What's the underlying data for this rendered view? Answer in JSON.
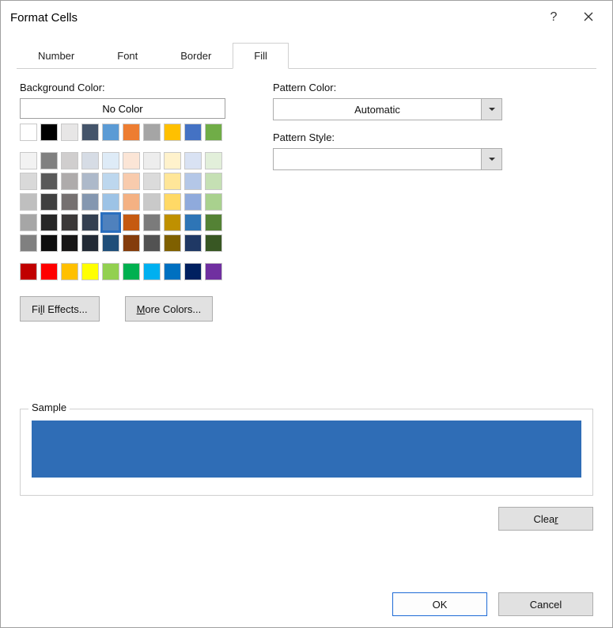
{
  "title": "Format Cells",
  "tabs": [
    "Number",
    "Font",
    "Border",
    "Fill"
  ],
  "active_tab": "Fill",
  "labels": {
    "background_color": "Background Color:",
    "pattern_color": "Pattern Color:",
    "pattern_style": "Pattern Style:",
    "no_color": "No Color",
    "sample": "Sample"
  },
  "buttons": {
    "fill_effects": "Fill Effects...",
    "more_colors": "More Colors...",
    "ok": "OK",
    "cancel": "Cancel",
    "clear": "Clear"
  },
  "dropdowns": {
    "pattern_color_value": "Automatic",
    "pattern_style_value": ""
  },
  "selected_color": "#4f81bd",
  "sample_color": "#2f6db6",
  "palette": {
    "theme_row": [
      "#ffffff",
      "#000000",
      "#e7e6e6",
      "#44546a",
      "#5b9bd5",
      "#ed7d31",
      "#a5a5a5",
      "#ffc000",
      "#4472c4",
      "#70ad47"
    ],
    "tints": [
      [
        "#f2f2f2",
        "#808080",
        "#d0cece",
        "#d6dce5",
        "#deebf7",
        "#fbe5d6",
        "#ededed",
        "#fff2cc",
        "#d9e2f3",
        "#e2efda"
      ],
      [
        "#d9d9d9",
        "#595959",
        "#aeabab",
        "#adb9ca",
        "#bdd7ee",
        "#f8cbad",
        "#dbdbdb",
        "#ffe699",
        "#b4c7e7",
        "#c5e0b4"
      ],
      [
        "#bfbfbf",
        "#404040",
        "#757070",
        "#8497b0",
        "#9dc3e6",
        "#f4b183",
        "#c9c9c9",
        "#ffd966",
        "#8faadc",
        "#a9d18e"
      ],
      [
        "#a6a6a6",
        "#262626",
        "#3b3838",
        "#333f50",
        "#4f81bd",
        "#c55a11",
        "#7b7b7b",
        "#bf9000",
        "#2e75b6",
        "#548235"
      ],
      [
        "#808080",
        "#0d0d0d",
        "#171616",
        "#222a35",
        "#1f4e79",
        "#843c0b",
        "#525252",
        "#7f6000",
        "#1f3864",
        "#385723"
      ]
    ],
    "standard": [
      "#c00000",
      "#ff0000",
      "#ffc000",
      "#ffff00",
      "#92d050",
      "#00b050",
      "#00b0f0",
      "#0070c0",
      "#002060",
      "#7030a0"
    ]
  }
}
